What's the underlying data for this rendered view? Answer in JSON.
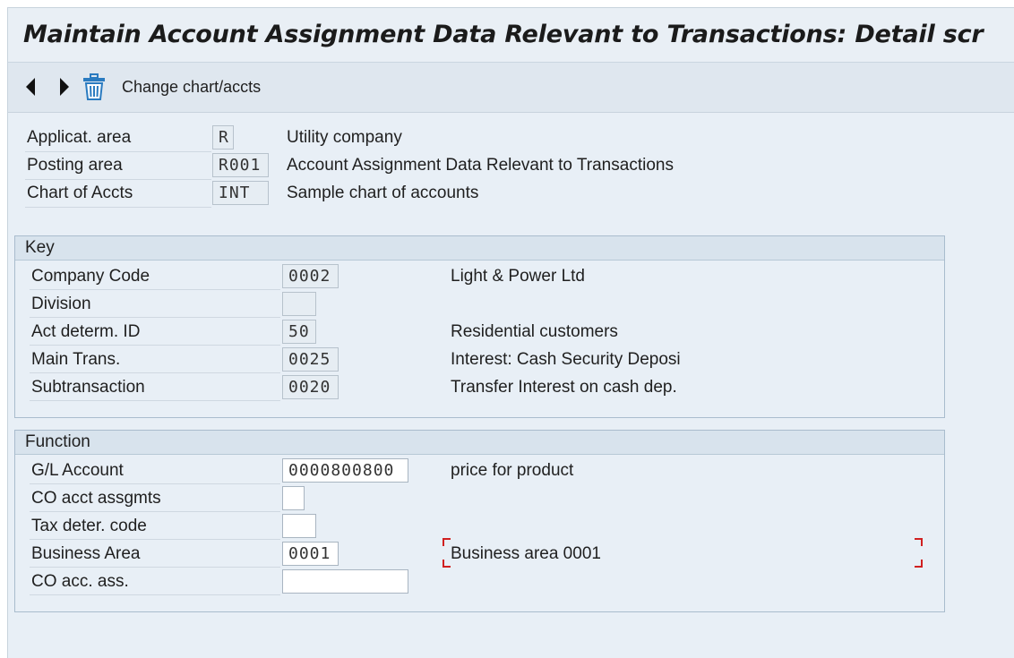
{
  "title": "Maintain Account Assignment Data Relevant to Transactions: Detail scr",
  "toolbar": {
    "back_icon": "triangle-left-icon",
    "forward_icon": "triangle-right-icon",
    "delete_icon": "trash-icon",
    "change_label": "Change chart/accts"
  },
  "header": {
    "rows": [
      {
        "label": "Applicat. area",
        "value": "R",
        "desc": "Utility company"
      },
      {
        "label": "Posting area",
        "value": "R001",
        "desc": "Account Assignment Data Relevant to Transactions"
      },
      {
        "label": "Chart of Accts",
        "value": "INT",
        "desc": "Sample chart of accounts"
      }
    ]
  },
  "key": {
    "title": "Key",
    "rows": [
      {
        "label": "Company Code",
        "value": "0002",
        "desc": "Light & Power Ltd"
      },
      {
        "label": "Division",
        "value": "",
        "desc": ""
      },
      {
        "label": "Act determ. ID",
        "value": "50",
        "desc": "Residential customers"
      },
      {
        "label": "Main Trans.",
        "value": "0025",
        "desc": "Interest: Cash Security Deposi"
      },
      {
        "label": "Subtransaction",
        "value": "0020",
        "desc": "Transfer Interest on cash dep."
      }
    ]
  },
  "function": {
    "title": "Function",
    "rows": [
      {
        "label": "G/L Account",
        "value": "0000800800",
        "desc": "price for product"
      },
      {
        "label": "CO acct assgmts",
        "value": "",
        "desc": ""
      },
      {
        "label": "Tax deter. code",
        "value": "",
        "desc": ""
      },
      {
        "label": "Business Area",
        "value": "0001",
        "desc": "Business area 0001"
      },
      {
        "label": "CO acc. ass.",
        "value": "",
        "desc": ""
      }
    ]
  },
  "colors": {
    "background": "#e8eff6",
    "accent_icon": "#2a7bc0",
    "focus_corner": "#d02020"
  }
}
